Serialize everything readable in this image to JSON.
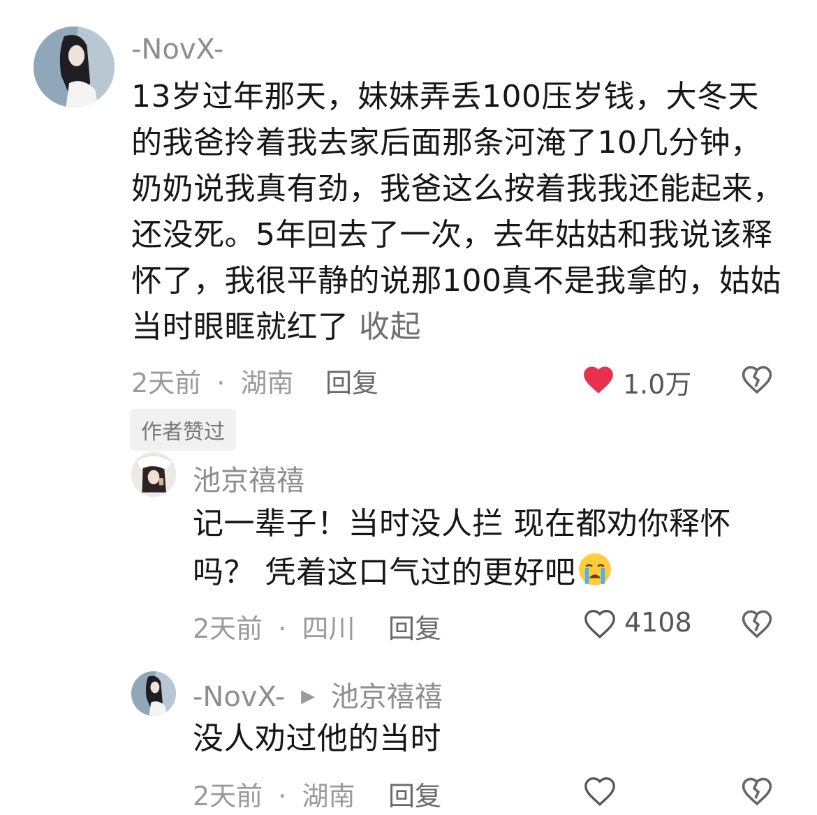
{
  "comments": [
    {
      "username": "-NovX-",
      "text": "13岁过年那天，妹妹弄丢100压岁钱，大冬天的我爸拎着我去家后面那条河淹了10几分钟，奶奶说我真有劲，我爸这么按着我我还能起来，还没死。5年回去了一次，去年姑姑和我说该释怀了，我很平静的说那100真不是我拿的，姑姑当时眼眶就红了",
      "collapse_label": "收起",
      "time": "2天前",
      "location": "湖南",
      "reply_label": "回复",
      "likes": "1.0万",
      "liked": true,
      "author_badge": "作者赞过"
    },
    {
      "username": "池京禧禧",
      "text": "记一辈子！当时没人拦 现在都劝你释怀吗？ 凭着这口气过的更好吧",
      "emoji": "crying-face-icon",
      "time": "2天前",
      "location": "四川",
      "reply_label": "回复",
      "likes": "4108"
    },
    {
      "username": "-NovX-",
      "reply_to": "池京禧禧",
      "text": "没人劝过他的当时",
      "time": "2天前",
      "location": "湖南",
      "reply_label": "回复"
    }
  ],
  "separator": "·",
  "colors": {
    "like_red": "#e8304f",
    "meta_gray": "#9a9a9a",
    "text": "#161616"
  }
}
